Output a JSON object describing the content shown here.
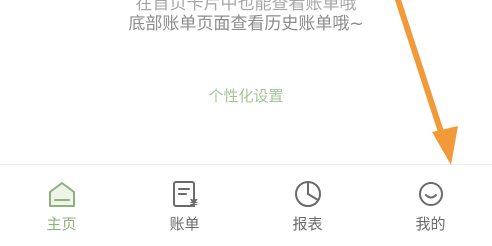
{
  "colors": {
    "accent_green": "#8db27c",
    "link_green": "#a5c49a",
    "inactive_gray": "#6a6a6a",
    "hint_gray": "#8c8c8c",
    "annotation_orange": "#f29a3a"
  },
  "hint": {
    "line_cut": "在首页卡片中也能查看账单哦",
    "line_main": "底部账单页面查看历史账单哦~"
  },
  "settings_link": "个性化设置",
  "tabs": [
    {
      "label": "主页",
      "icon": "home-icon",
      "active": true
    },
    {
      "label": "账单",
      "icon": "bill-icon",
      "active": false
    },
    {
      "label": "报表",
      "icon": "report-pie-icon",
      "active": false
    },
    {
      "label": "我的",
      "icon": "smiley-profile-icon",
      "active": false
    }
  ]
}
